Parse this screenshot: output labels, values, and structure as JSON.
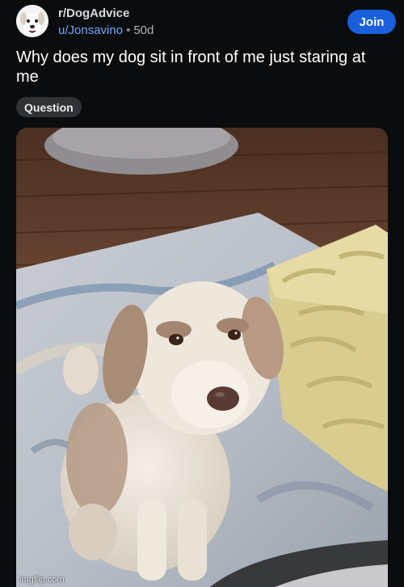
{
  "post": {
    "subreddit": "r/DogAdvice",
    "username": "u/Jonsavino",
    "separator": "•",
    "age": "50d",
    "join_label": "Join",
    "title": "Why does my dog sit in front of me just staring at me",
    "flair": "Question"
  },
  "image": {
    "subject": "dog-photo"
  },
  "watermark": "imgflip.com",
  "colors": {
    "background": "#0b0c0e",
    "join_button": "#1a60dc",
    "username": "#6ea8ff",
    "flair_bg": "#2f3338"
  }
}
